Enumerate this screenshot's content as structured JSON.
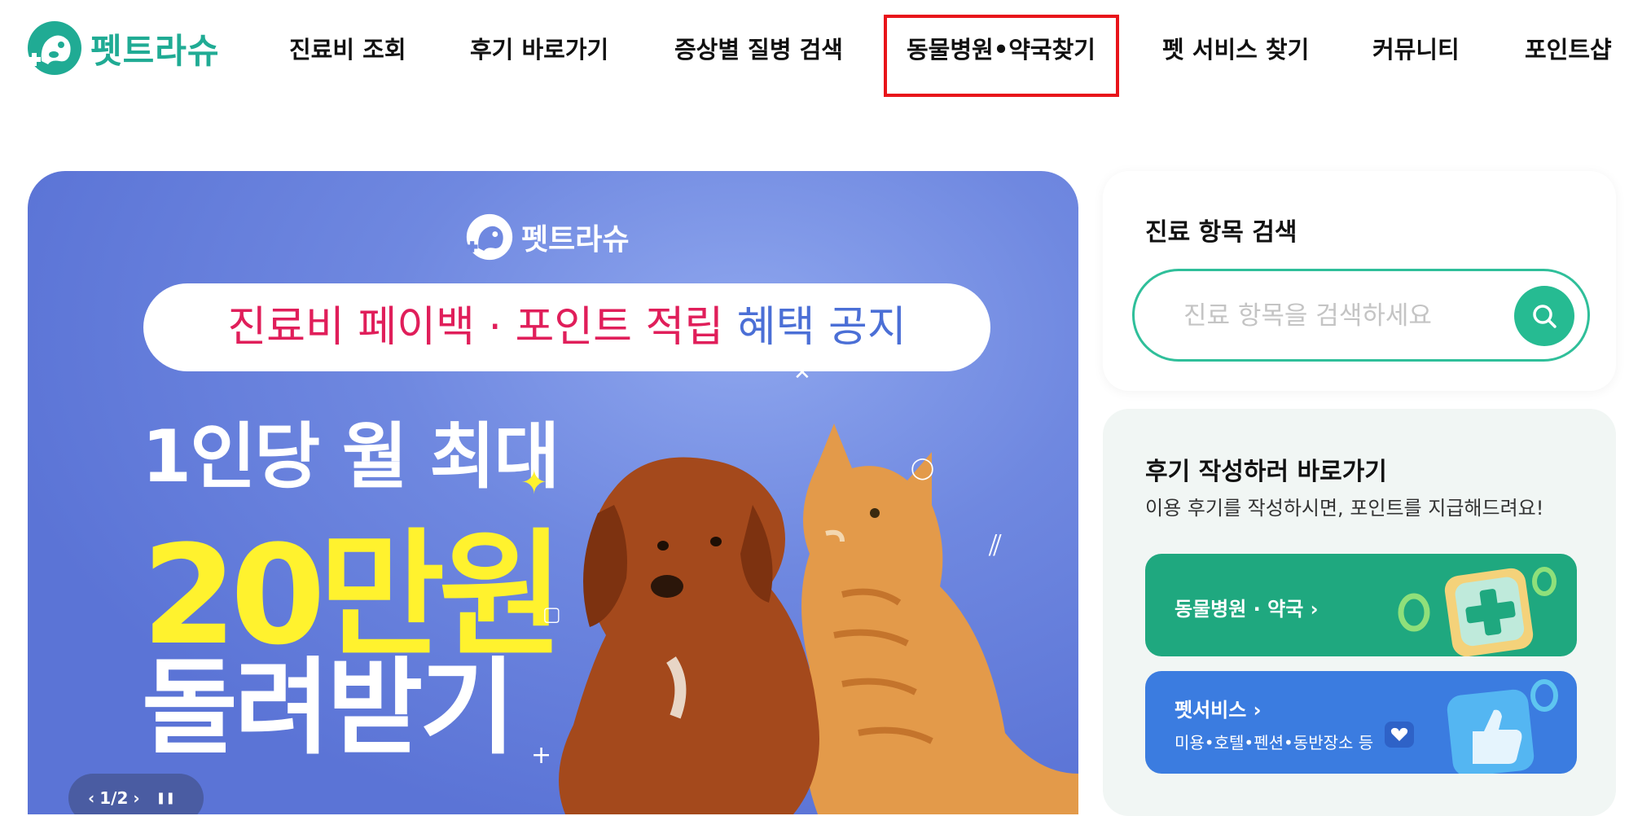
{
  "brand": {
    "name": "펫트라슈",
    "color": "#20ab94"
  },
  "nav": {
    "items": [
      {
        "label": "진료비 조회"
      },
      {
        "label": "후기 바로가기"
      },
      {
        "label": "증상별 질병 검색"
      },
      {
        "label": "동물병원•약국찾기"
      },
      {
        "label": "펫 서비스 찾기"
      },
      {
        "label": "커뮤니티"
      },
      {
        "label": "포인트샵"
      }
    ],
    "highlight_color": "#e8141a"
  },
  "banner": {
    "logo_text": "펫트라슈",
    "notice_red": "진료비 페이백 · 포인트 적립",
    "notice_blue": "혜택 공지",
    "line1": "1인당 월 최대",
    "line2": "20만원",
    "line3": "돌려받기",
    "pager": {
      "prev": "‹",
      "current": "1/2",
      "next": "›",
      "pause": "❚❚"
    },
    "bg_color": "#6f88e0",
    "accent_yellow": "#fff22e"
  },
  "search": {
    "title": "진료 항목 검색",
    "placeholder": "진료 항목을 검색하세요",
    "value": "",
    "button_color": "#26bb92"
  },
  "review": {
    "title": "후기 작성하러 바로가기",
    "subtitle": "이용 후기를 작성하시면, 포인트를 지급해드려요!",
    "cta_hospital": {
      "label": "동물병원 · 약국 ›",
      "color": "#1fa87f"
    },
    "cta_service": {
      "label": "펫서비스 ›",
      "desc": "미용•호텔•펜션•동반장소 등",
      "color": "#3b7ce0"
    }
  }
}
